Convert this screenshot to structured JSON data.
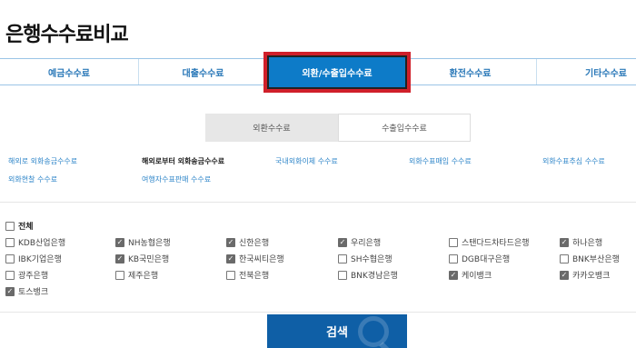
{
  "page": {
    "title": "은행수수료비교"
  },
  "main_tabs": [
    {
      "label": "예금수수료"
    },
    {
      "label": "대출수수료"
    },
    {
      "label": "외환/수출입수수료"
    },
    {
      "label": "환전수수료"
    },
    {
      "label": "기타수수료"
    }
  ],
  "sub_tabs": [
    {
      "label": "외환수수료"
    },
    {
      "label": "수출입수수료"
    }
  ],
  "fee_links": [
    {
      "label": "해외로 외화송금수수료"
    },
    {
      "label": "해외로부터 외화송금수수료"
    },
    {
      "label": "국내외화이체 수수료"
    },
    {
      "label": "외화수표매입 수수료"
    },
    {
      "label": "외화수표추심 수수료"
    },
    {
      "label": "외화현찰 수수료"
    },
    {
      "label": "여행자수표판매 수수료"
    }
  ],
  "select_all": {
    "label": "전체",
    "checked": false
  },
  "banks": [
    {
      "label": "KDB산업은행",
      "checked": false
    },
    {
      "label": "NH농협은행",
      "checked": true
    },
    {
      "label": "신한은행",
      "checked": true
    },
    {
      "label": "우리은행",
      "checked": true
    },
    {
      "label": "스탠다드차타드은행",
      "checked": false
    },
    {
      "label": "하나은행",
      "checked": true
    },
    {
      "label": "IBK기업은행",
      "checked": false
    },
    {
      "label": "KB국민은행",
      "checked": true
    },
    {
      "label": "한국씨티은행",
      "checked": true
    },
    {
      "label": "SH수협은행",
      "checked": false
    },
    {
      "label": "DGB대구은행",
      "checked": false
    },
    {
      "label": "BNK부산은행",
      "checked": false
    },
    {
      "label": "광주은행",
      "checked": false
    },
    {
      "label": "제주은행",
      "checked": false
    },
    {
      "label": "전북은행",
      "checked": false
    },
    {
      "label": "BNK경남은행",
      "checked": false
    },
    {
      "label": "케이뱅크",
      "checked": true
    },
    {
      "label": "카카오뱅크",
      "checked": true
    },
    {
      "label": "토스뱅크",
      "checked": true
    }
  ],
  "search_button": {
    "label": "검색"
  },
  "colors": {
    "accent": "#0d7bc8",
    "highlight": "#d0202a",
    "button": "#0f5fa6",
    "link": "#2f86c9"
  }
}
